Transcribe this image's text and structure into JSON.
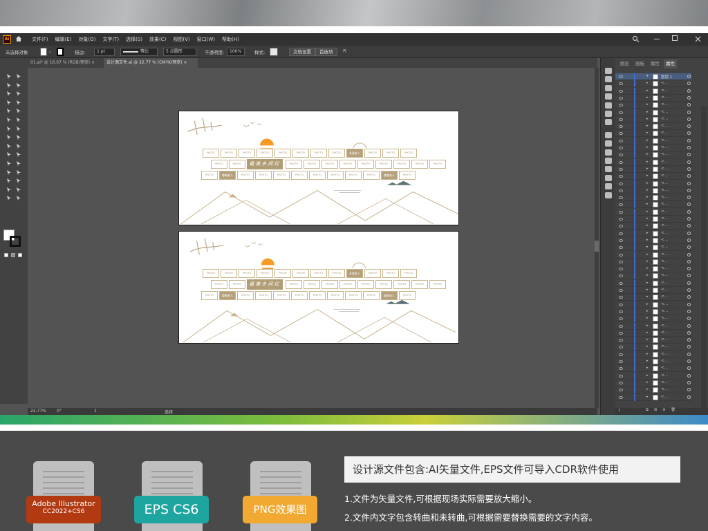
{
  "app": {
    "logo": "Ai"
  },
  "menu": [
    "文件(F)",
    "编辑(E)",
    "对象(O)",
    "文字(T)",
    "选择(S)",
    "效果(C)",
    "视图(V)",
    "窗口(W)",
    "帮助(H)"
  ],
  "control_bar": {
    "selection_status": "未选择对象",
    "stroke_label": "描边:",
    "stroke_value": "1 pt",
    "stroke_style": "等比",
    "brush": "5 点圆形",
    "opacity_label": "不透明度:",
    "opacity_value": "100%",
    "style_label": "样式:",
    "doc_setup_button": "文档设置",
    "preferences_button": "首选项"
  },
  "tabs": [
    {
      "label": "01.ai* @ 16.67 % (RGB/预览)",
      "active": false
    },
    {
      "label": "设计源文件.ai @ 22.77 % (CMYK/预览)",
      "active": true
    }
  ],
  "status_bar": {
    "zoom": "22.77%",
    "angle": "0°",
    "page": "1",
    "tool": "选择"
  },
  "layers_panel": {
    "tabs": [
      "图层",
      "画板",
      "属性"
    ],
    "active_tab": "属性",
    "top_layer": "图层 1",
    "item_name": "<…",
    "row_count": 46,
    "footer_count": "1"
  },
  "artboard_content": {
    "title": "最美乡间红",
    "photo_label": "PHOTO",
    "label_caring": "关爱老人",
    "label_respect": "尊敬老人"
  },
  "info": {
    "files": [
      {
        "name": "Adobe Illustrator",
        "version": "CC2022+CS6",
        "color": "#b23a12"
      },
      {
        "name": "EPS CS6",
        "color": "#1fa5a0"
      },
      {
        "name": "PNG效果图",
        "color": "#f2a931"
      }
    ],
    "title": "设计源文件包含:AI矢量文件,EPS文件可导入CDR软件使用",
    "notes": [
      "1.文件为矢量文件,可根据现场实际需要放大缩小。",
      "2.文件内文字包含转曲和未转曲,可根据需要替换需要的文字内容。"
    ]
  },
  "colors": {
    "app_bg": "#535353",
    "menubar_bg": "#323232",
    "accent_gold": "#b19d75",
    "sun_orange": "#f59a23",
    "layer_blue": "#3f6bd6"
  }
}
